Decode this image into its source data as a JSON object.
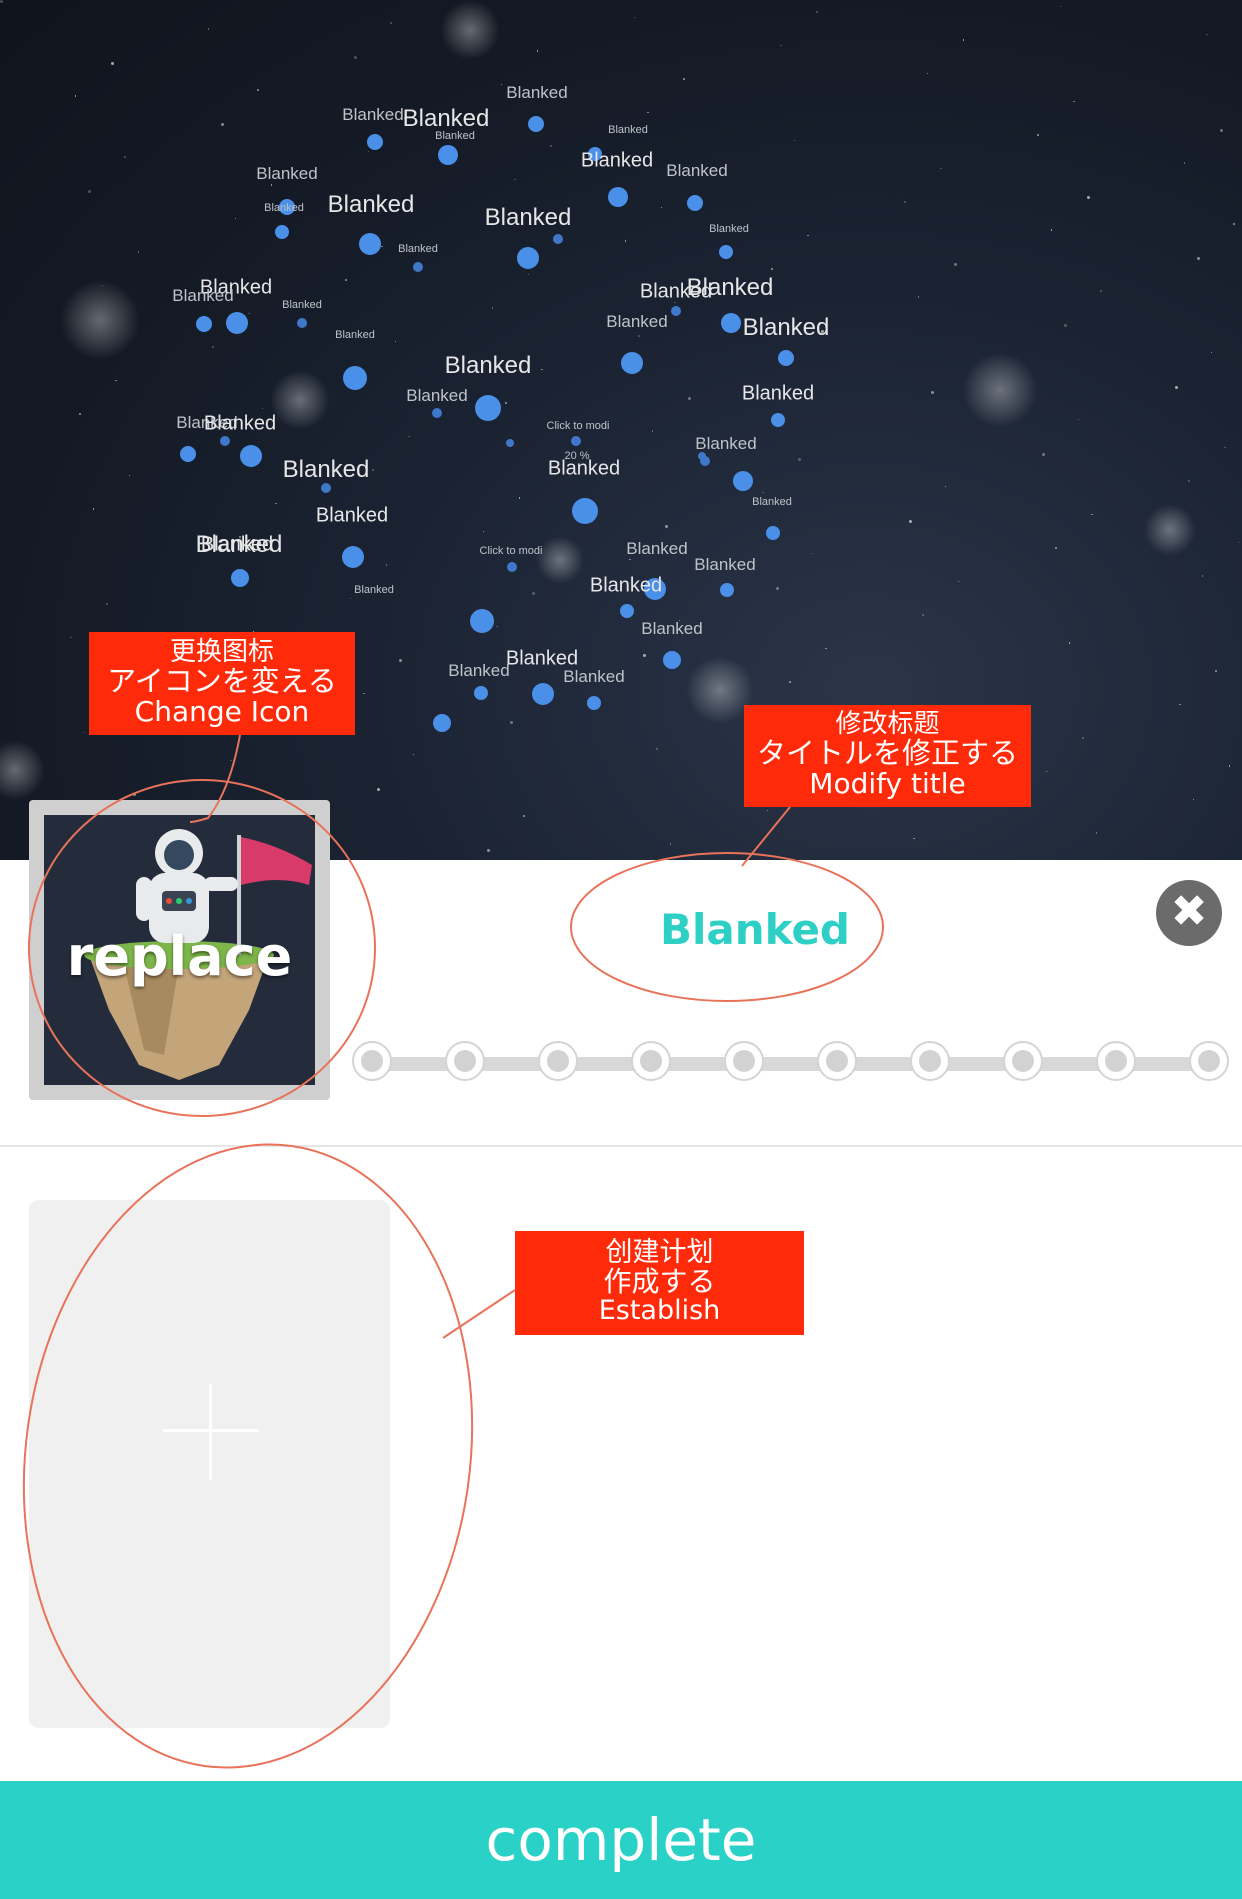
{
  "constellation": {
    "labels": [
      {
        "text": "Blanked",
        "size": "small",
        "dim": true
      },
      {
        "text": "Blanked",
        "size": "big"
      },
      {
        "text": "Blanked",
        "size": "tiny",
        "dim": true
      },
      {
        "text": "Blanked",
        "size": "small",
        "dim": true
      },
      {
        "text": "Blanked",
        "size": "tiny",
        "dim": true
      },
      {
        "text": "Blanked",
        "size": "mid"
      },
      {
        "text": "Blanked",
        "size": "small",
        "dim": true
      },
      {
        "text": "Blanked",
        "size": "small",
        "dim": true
      },
      {
        "text": "Blanked",
        "size": "tiny",
        "dim": true
      },
      {
        "text": "Blanked",
        "size": "big"
      },
      {
        "text": "Blanked",
        "size": "big"
      },
      {
        "text": "Blanked",
        "size": "tiny",
        "dim": true
      },
      {
        "text": "Blanked",
        "size": "tiny",
        "dim": true
      },
      {
        "text": "Blanked",
        "size": "mid"
      },
      {
        "text": "Blanked",
        "size": "small",
        "dim": true
      },
      {
        "text": "Blanked",
        "size": "tiny",
        "dim": true
      },
      {
        "text": "Blanked",
        "size": "mid"
      },
      {
        "text": "Blanked",
        "size": "big"
      },
      {
        "text": "Blanked",
        "size": "big"
      },
      {
        "text": "Blanked",
        "size": "small",
        "dim": true
      },
      {
        "text": "Blanked",
        "size": "tiny",
        "dim": true
      },
      {
        "text": "Blanked",
        "size": "big"
      },
      {
        "text": "Blanked",
        "size": "small",
        "dim": true
      },
      {
        "text": "Blanked",
        "size": "mid"
      },
      {
        "text": "Blanked",
        "size": "small",
        "dim": true
      },
      {
        "text": "Blanked",
        "size": "mid"
      },
      {
        "text": "Blanked",
        "size": "big"
      },
      {
        "text": "Blanked",
        "size": "tiny",
        "dim": true
      },
      {
        "text": "Blanked",
        "size": "mid"
      },
      {
        "text": "Blanked",
        "size": "small",
        "dim": true
      },
      {
        "text": "Blanked",
        "size": "mid"
      },
      {
        "text": "Blanked",
        "size": "big"
      },
      {
        "text": "Blanked",
        "size": "small",
        "dim": true
      },
      {
        "text": "Blanked",
        "size": "tiny",
        "dim": true
      },
      {
        "text": "Blanked",
        "size": "mid"
      },
      {
        "text": "Blanked",
        "size": "mid"
      },
      {
        "text": "Blanked",
        "size": "small",
        "dim": true
      },
      {
        "text": "Blanked",
        "size": "small",
        "dim": true
      },
      {
        "text": "Blanked",
        "size": "mid"
      },
      {
        "text": "Blanked",
        "size": "small",
        "dim": true
      },
      {
        "text": "Blanked",
        "size": "small",
        "dim": true
      },
      {
        "text": "Click to modi",
        "size": "tiny",
        "dim": true
      },
      {
        "text": "Click to modi",
        "size": "tiny",
        "dim": true
      },
      {
        "text": "20 %",
        "size": "tiny",
        "dim": true
      }
    ]
  },
  "callouts": {
    "change_icon": {
      "zh": "更换图标",
      "ja": "アイコンを変える",
      "en": "Change Icon"
    },
    "modify_title": {
      "zh": "修改标题",
      "ja": "タイトルを修正する",
      "en": "Modify title"
    },
    "establish": {
      "zh": "创建计划",
      "ja": "作成する",
      "en": "Establish"
    }
  },
  "editor": {
    "icon_overlay_label": "replace",
    "title": "Blanked",
    "close_icon": "close-icon",
    "progress_steps": 10
  },
  "plan": {
    "add_icon": "plus-icon"
  },
  "footer": {
    "complete_label": "complete"
  },
  "colors": {
    "accent": "#2ad1c6",
    "title": "#2ecfc4",
    "callout": "#ff2a0a",
    "node": "#4a8fe8"
  }
}
